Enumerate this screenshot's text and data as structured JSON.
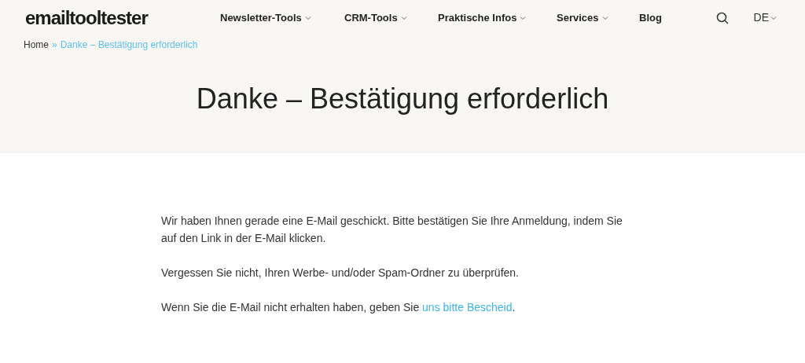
{
  "logo": "emailtooltester",
  "nav": [
    {
      "label": "Newsletter-Tools",
      "has_dropdown": true
    },
    {
      "label": "CRM-Tools",
      "has_dropdown": true
    },
    {
      "label": "Praktische Infos",
      "has_dropdown": true
    },
    {
      "label": "Services",
      "has_dropdown": true
    },
    {
      "label": "Blog",
      "has_dropdown": false
    }
  ],
  "language": "DE",
  "breadcrumb": [
    {
      "label": "Home",
      "current": false
    },
    {
      "label": "Danke – Bestätigung erforderlich",
      "current": true
    }
  ],
  "breadcrumb_separator": "»",
  "title": "Danke – Bestätigung erforderlich",
  "paragraphs": [
    {
      "text": "Wir haben Ihnen gerade eine E-Mail geschickt. Bitte bestätigen Sie Ihre Anmeldung, indem Sie auf den Link in der E-Mail klicken."
    },
    {
      "text": "Vergessen Sie nicht, Ihren Werbe- und/oder Spam-Ordner zu überprüfen."
    },
    {
      "text": "Wenn Sie die E-Mail nicht erhalten haben, geben Sie ",
      "link": "uns bitte Bescheid",
      "after": "."
    }
  ]
}
